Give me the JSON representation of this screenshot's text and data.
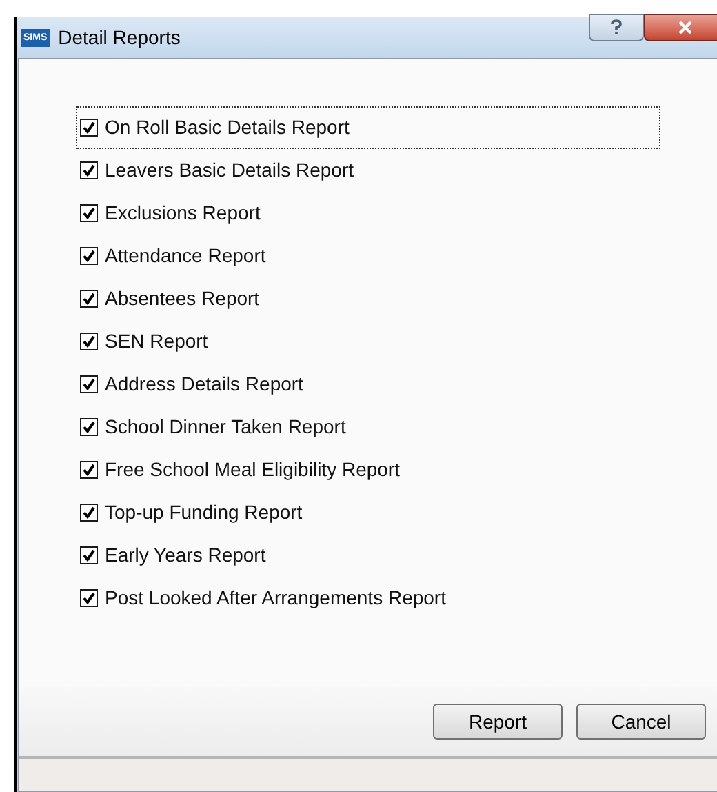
{
  "window": {
    "title": "Detail Reports",
    "app_badge": "SIMS"
  },
  "reports": [
    {
      "label": "On Roll Basic Details Report",
      "checked": true,
      "focused": true
    },
    {
      "label": "Leavers Basic Details Report",
      "checked": true,
      "focused": false
    },
    {
      "label": "Exclusions Report",
      "checked": true,
      "focused": false
    },
    {
      "label": "Attendance Report",
      "checked": true,
      "focused": false
    },
    {
      "label": "Absentees Report",
      "checked": true,
      "focused": false
    },
    {
      "label": "SEN Report",
      "checked": true,
      "focused": false
    },
    {
      "label": "Address Details Report",
      "checked": true,
      "focused": false
    },
    {
      "label": "School Dinner Taken Report",
      "checked": true,
      "focused": false
    },
    {
      "label": "Free School Meal Eligibility Report",
      "checked": true,
      "focused": false
    },
    {
      "label": "Top-up Funding Report",
      "checked": true,
      "focused": false
    },
    {
      "label": "Early Years Report",
      "checked": true,
      "focused": false
    },
    {
      "label": "Post Looked After Arrangements Report",
      "checked": true,
      "focused": false
    }
  ],
  "buttons": [
    "Report",
    "Cancel"
  ]
}
